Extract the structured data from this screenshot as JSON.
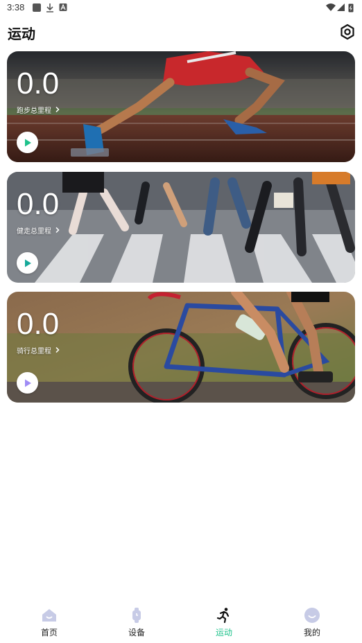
{
  "status_bar": {
    "time": "3:38"
  },
  "header": {
    "title": "运动"
  },
  "cards": [
    {
      "value": "0.0",
      "label": "跑步总里程",
      "play_color": "#1ec28b"
    },
    {
      "value": "0.0",
      "label": "健走总里程",
      "play_color": "#16a99a"
    },
    {
      "value": "0.0",
      "label": "骑行总里程",
      "play_color": "#9f8cf5"
    }
  ],
  "tabs": [
    {
      "label": "首页",
      "icon": "home-icon"
    },
    {
      "label": "设备",
      "icon": "watch-icon"
    },
    {
      "label": "运动",
      "icon": "runner-icon",
      "active": true
    },
    {
      "label": "我的",
      "icon": "profile-smile-icon"
    }
  ],
  "colors": {
    "accent": "#1ec28b",
    "inactive_icon": "#c7cbe6"
  }
}
